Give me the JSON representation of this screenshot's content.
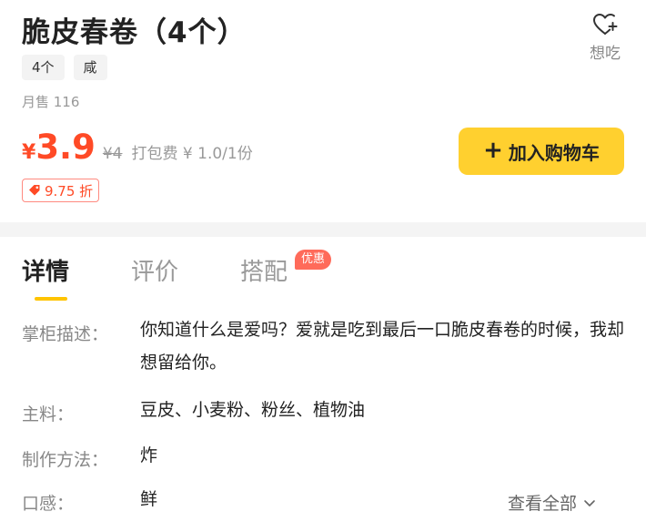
{
  "product": {
    "title": "脆皮春卷（4个）",
    "tags": [
      "4个",
      "咸"
    ],
    "sales": "月售 116",
    "price": {
      "currency": "¥",
      "value": "3.9",
      "original": "¥4",
      "packing_fee": "打包费 ¥ 1.0/1份"
    },
    "discount": "9.75 折",
    "add_to_cart": "加入购物车",
    "wish_label": "想吃"
  },
  "tabs": {
    "items": [
      "详情",
      "评价",
      "搭配"
    ],
    "active": 0,
    "badge": "优惠"
  },
  "details": {
    "rows": [
      {
        "label": "掌柜描述：",
        "value": "你知道什么是爱吗？爱就是吃到最后一口脆皮春卷的时候，我却想留给你。"
      },
      {
        "label": "主料：",
        "value": "豆皮、小麦粉、粉丝、植物油"
      },
      {
        "label": "制作方法：",
        "value": "炸"
      },
      {
        "label": "口感：",
        "value": "鲜"
      }
    ],
    "view_all": "查看全部"
  },
  "colors": {
    "price": "#ff4a26",
    "accent_button": "#ffd02f",
    "tab_indicator": "#ffc400",
    "badge": "#ff6b5a"
  },
  "icons": {
    "wish": "heart-plus-icon",
    "discount": "tag-icon",
    "view_all": "chevron-down-icon"
  }
}
